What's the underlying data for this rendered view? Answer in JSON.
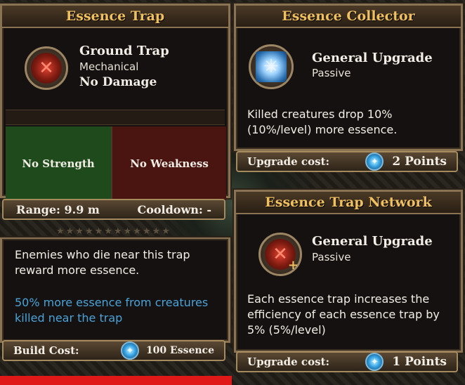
{
  "left_panel": {
    "title": "Essence Trap",
    "trap_name": "Ground Trap",
    "trap_type": "Mechanical",
    "damage": "No Damage",
    "strength": "No Strength",
    "weakness": "No Weakness",
    "range": "Range: 9.9 m",
    "cooldown": "Cooldown: -",
    "description": "Enemies who die near this trap reward more essence.",
    "bonus_text": "50% more essence from creatures killed near the trap",
    "build_cost_label": "Build Cost:",
    "build_cost_value": "100 Essence",
    "icon": "ground-trap-icon",
    "currency_icon": "essence-crystal-icon"
  },
  "collector_panel": {
    "title": "Essence Collector",
    "upgrade_type": "General Upgrade",
    "upgrade_kind": "Passive",
    "description": "Killed creatures drop 10% (10%/level) more essence.",
    "cost_label": "Upgrade cost:",
    "cost_value": "2 Points",
    "icon": "essence-collector-icon"
  },
  "network_panel": {
    "title": "Essence Trap Network",
    "upgrade_type": "General Upgrade",
    "upgrade_kind": "Passive",
    "description": "Each essence trap increases the efficiency of each essence trap by 5% (5%/level)",
    "cost_label": "Upgrade cost:",
    "cost_value": "1 Points",
    "icon": "trap-network-icon"
  },
  "colors": {
    "title_gold": "#f0c060",
    "strength_bg": "#1f4a1c",
    "weakness_bg": "#4a1410",
    "bonus_blue": "#4aa3d8",
    "highlight_red": "#e01818"
  }
}
